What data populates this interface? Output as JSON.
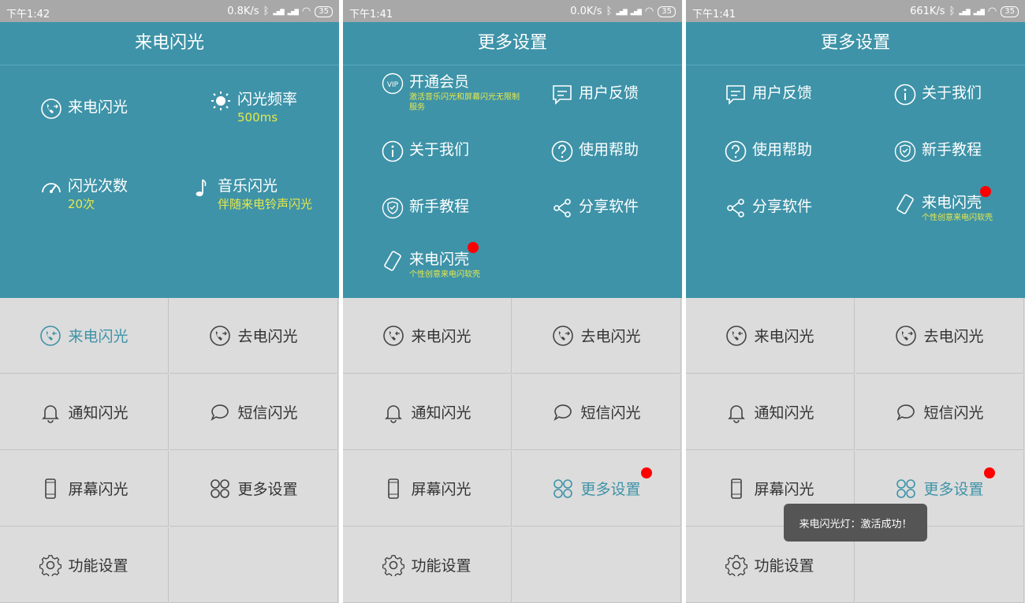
{
  "screens": [
    {
      "status": {
        "time": "下午1:42",
        "speed": "0.8K/s",
        "battery": "35"
      },
      "header": {
        "title": "来电闪光"
      },
      "panel": {
        "items": [
          {
            "label": "来电闪光",
            "sub": "",
            "icon": "phone-icon"
          },
          {
            "label": "闪光频率",
            "sub": "500ms",
            "icon": "sun-icon"
          },
          {
            "label": "闪光次数",
            "sub": "20次",
            "icon": "gauge-icon"
          },
          {
            "label": "音乐闪光",
            "sub": "伴随来电铃声闪光",
            "icon": "music-note-icon"
          }
        ]
      },
      "grid": [
        {
          "label": "来电闪光",
          "icon": "incoming-call-icon"
        },
        {
          "label": "去电闪光",
          "icon": "outgoing-call-icon"
        },
        {
          "label": "通知闪光",
          "icon": "bell-icon"
        },
        {
          "label": "短信闪光",
          "icon": "chat-bubble-icon"
        },
        {
          "label": "屏幕闪光",
          "icon": "phone-screen-icon"
        },
        {
          "label": "更多设置",
          "icon": "four-circles-icon"
        },
        {
          "label": "功能设置",
          "icon": "gear-icon"
        }
      ]
    },
    {
      "status": {
        "time": "下午1:41",
        "speed": "0.0K/s",
        "battery": "35"
      },
      "header": {
        "title": "更多设置"
      },
      "panel": {
        "items": [
          {
            "label": "开通会员",
            "sub": "激活音乐闪光和屏幕闪光无限制服务",
            "icon": "vip-icon"
          },
          {
            "label": "用户反馈",
            "sub": "",
            "icon": "feedback-icon"
          },
          {
            "label": "关于我们",
            "sub": "",
            "icon": "info-icon"
          },
          {
            "label": "使用帮助",
            "sub": "",
            "icon": "help-icon"
          },
          {
            "label": "新手教程",
            "sub": "",
            "icon": "shield-icon"
          },
          {
            "label": "分享软件",
            "sub": "",
            "icon": "share-icon"
          },
          {
            "label": "来电闪壳",
            "sub": "个性创意来电闪软壳",
            "icon": "phone-case-icon"
          }
        ]
      },
      "grid": [
        {
          "label": "来电闪光",
          "icon": "incoming-call-icon"
        },
        {
          "label": "去电闪光",
          "icon": "outgoing-call-icon"
        },
        {
          "label": "通知闪光",
          "icon": "bell-icon"
        },
        {
          "label": "短信闪光",
          "icon": "chat-bubble-icon"
        },
        {
          "label": "屏幕闪光",
          "icon": "phone-screen-icon"
        },
        {
          "label": "更多设置",
          "icon": "four-circles-icon"
        },
        {
          "label": "功能设置",
          "icon": "gear-icon"
        }
      ]
    },
    {
      "status": {
        "time": "下午1:41",
        "speed": "661K/s",
        "battery": "35"
      },
      "header": {
        "title": "更多设置"
      },
      "panel": {
        "items": [
          {
            "label": "用户反馈",
            "sub": "",
            "icon": "feedback-icon"
          },
          {
            "label": "关于我们",
            "sub": "",
            "icon": "info-icon"
          },
          {
            "label": "使用帮助",
            "sub": "",
            "icon": "help-icon"
          },
          {
            "label": "新手教程",
            "sub": "",
            "icon": "shield-icon"
          },
          {
            "label": "分享软件",
            "sub": "",
            "icon": "share-icon"
          },
          {
            "label": "来电闪壳",
            "sub": "个性创意来电闪软壳",
            "icon": "phone-case-icon"
          }
        ]
      },
      "grid": [
        {
          "label": "来电闪光",
          "icon": "incoming-call-icon"
        },
        {
          "label": "去电闪光",
          "icon": "outgoing-call-icon"
        },
        {
          "label": "通知闪光",
          "icon": "bell-icon"
        },
        {
          "label": "短信闪光",
          "icon": "chat-bubble-icon"
        },
        {
          "label": "屏幕闪光",
          "icon": "phone-screen-icon"
        },
        {
          "label": "更多设置",
          "icon": "four-circles-icon"
        },
        {
          "label": "功能设置",
          "icon": "gear-icon"
        }
      ],
      "toast": "来电闪光灯：激活成功！"
    }
  ],
  "colors": {
    "header_bg": "#3e93a8",
    "grid_bg": "#dcdcdc",
    "accent": "#3e93a8",
    "sub_text": "#e8e84a",
    "badge": "#ff0000",
    "status_bg": "#a8a8a8"
  }
}
